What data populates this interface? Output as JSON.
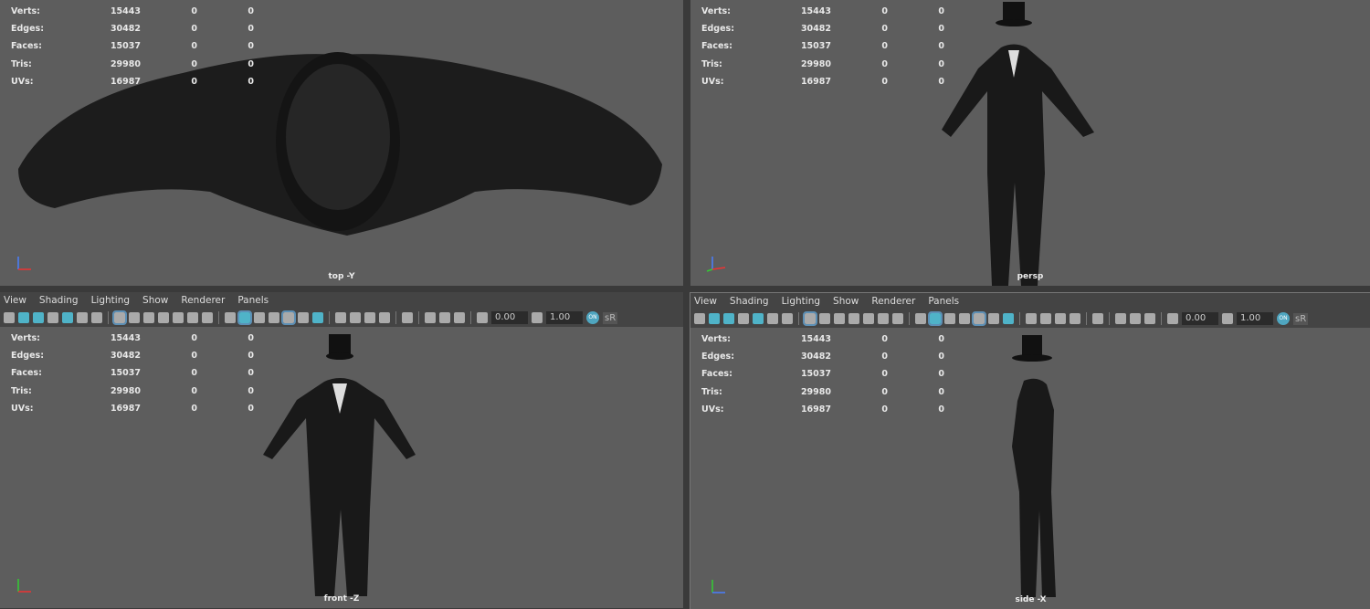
{
  "menu": [
    "View",
    "Shading",
    "Lighting",
    "Show",
    "Renderer",
    "Panels"
  ],
  "toolbar": {
    "exposure": "0.00",
    "gamma": "1.00",
    "color_mgmt": "ON",
    "view_transform": "sR"
  },
  "hud": {
    "labels": [
      "Verts:",
      "Edges:",
      "Faces:",
      "Tris:",
      "UVs:"
    ],
    "values": [
      "15443",
      "30482",
      "15037",
      "29980",
      "16987"
    ],
    "sel": [
      "0",
      "0",
      "0",
      "0",
      "0"
    ],
    "sel2": [
      "0",
      "0",
      "0",
      "0",
      "0"
    ]
  },
  "viewports": {
    "top": "top -Y",
    "persp": "persp",
    "front": "front -Z",
    "side": "side -X"
  },
  "colors": {
    "viewport_bg": "#5d5d5d",
    "panel_bg": "#444444",
    "accent": "#4fb3c8"
  }
}
